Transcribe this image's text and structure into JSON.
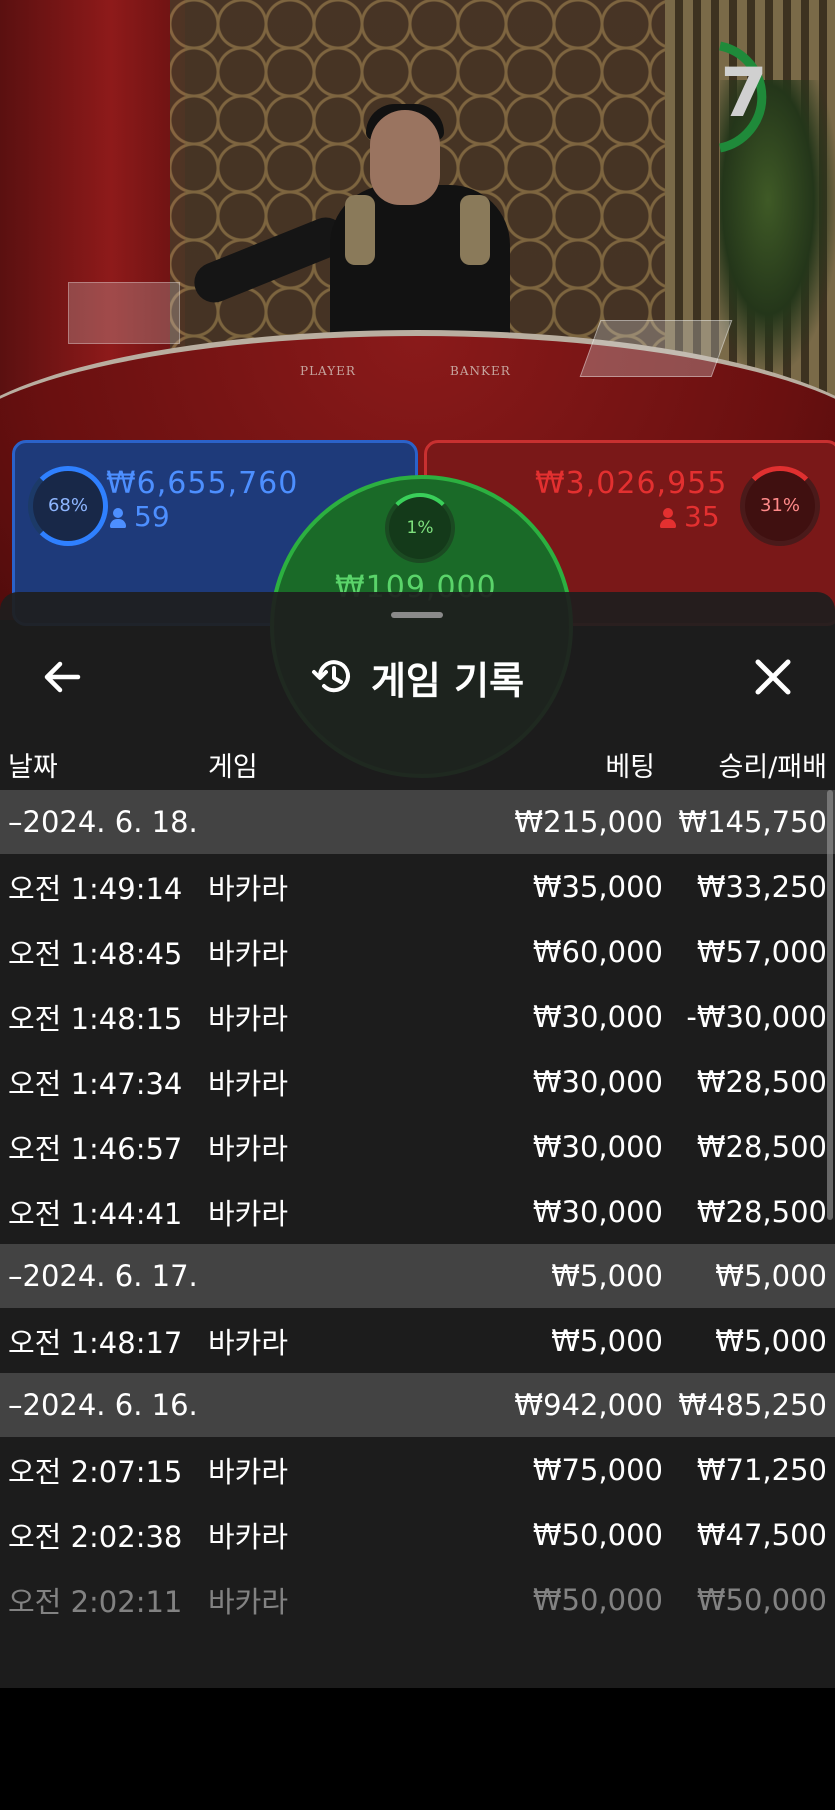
{
  "timer": {
    "value": "7"
  },
  "bets": {
    "player": {
      "percent": "68%",
      "amount": "₩6,655,760",
      "players": "59"
    },
    "banker": {
      "percent": "31%",
      "amount": "₩3,026,955",
      "players": "35"
    },
    "tie": {
      "percent": "1%",
      "amount": "₩109,000"
    }
  },
  "table_labels": {
    "player": "PLAYER",
    "banker": "BANKER"
  },
  "sheet": {
    "title": "게임 기록",
    "columns": {
      "date": "날짜",
      "game": "게임",
      "bet": "베팅",
      "result": "승리/패배"
    },
    "groups": [
      {
        "date": "–2024. 6. 18.",
        "bet": "₩215,000",
        "result": "₩145,750",
        "items": [
          {
            "time": "오전 1:49:14",
            "game": "바카라",
            "bet": "₩35,000",
            "result": "₩33,250"
          },
          {
            "time": "오전 1:48:45",
            "game": "바카라",
            "bet": "₩60,000",
            "result": "₩57,000"
          },
          {
            "time": "오전 1:48:15",
            "game": "바카라",
            "bet": "₩30,000",
            "result": "-₩30,000"
          },
          {
            "time": "오전 1:47:34",
            "game": "바카라",
            "bet": "₩30,000",
            "result": "₩28,500"
          },
          {
            "time": "오전 1:46:57",
            "game": "바카라",
            "bet": "₩30,000",
            "result": "₩28,500"
          },
          {
            "time": "오전 1:44:41",
            "game": "바카라",
            "bet": "₩30,000",
            "result": "₩28,500"
          }
        ]
      },
      {
        "date": "–2024. 6. 17.",
        "bet": "₩5,000",
        "result": "₩5,000",
        "items": [
          {
            "time": "오전 1:48:17",
            "game": "바카라",
            "bet": "₩5,000",
            "result": "₩5,000"
          }
        ]
      },
      {
        "date": "–2024. 6. 16.",
        "bet": "₩942,000",
        "result": "₩485,250",
        "items": [
          {
            "time": "오전 2:07:15",
            "game": "바카라",
            "bet": "₩75,000",
            "result": "₩71,250"
          },
          {
            "time": "오전 2:02:38",
            "game": "바카라",
            "bet": "₩50,000",
            "result": "₩47,500"
          },
          {
            "time": "오전 2:02:11",
            "game": "바카라",
            "bet": "₩50,000",
            "result": "₩50,000"
          }
        ]
      }
    ]
  },
  "icons": {
    "back": "arrow-left-icon",
    "history": "history-icon",
    "close": "close-icon",
    "person": "person-icon"
  },
  "colors": {
    "player": "#2b62c9",
    "banker": "#c83030",
    "tie": "#2cb040",
    "sheet": "#1e1e1e"
  }
}
